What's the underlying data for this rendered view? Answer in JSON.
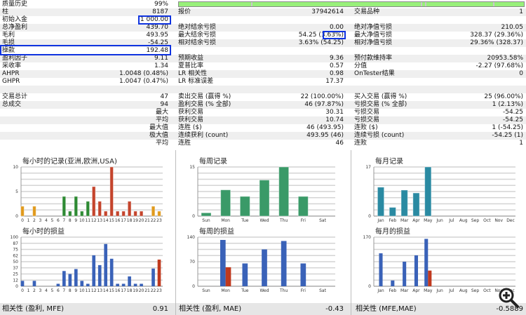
{
  "quality": {
    "label": "质量历史",
    "value": "99%"
  },
  "stats_rows": [
    [
      "柱",
      "8187",
      "报价",
      "37942614",
      "交易品种",
      "1"
    ],
    [
      "初始入金",
      "1 000.00",
      "",
      "",
      "",
      ""
    ],
    [
      "总净盈利",
      "439.70",
      "绝对结余亏损",
      "0.00",
      "绝对净值亏损",
      "210.05"
    ],
    [
      "毛利",
      "493.95",
      "最大结余亏损",
      "54.25 (3.63%)",
      "最大净值亏损",
      "328.37 (29.36%)"
    ],
    [
      "毛损",
      "-54.25",
      "相对结余亏损",
      "3.63% (54.25)",
      "相对净值亏损",
      "29.36% (328.37)"
    ],
    [
      "操款",
      "192.48",
      "",
      "",
      "",
      ""
    ],
    [
      "盈利因子",
      "9.11",
      "预期收益",
      "9.36",
      "预付款维持率",
      "20953.58%"
    ],
    [
      "采收率",
      "1.34",
      "夏普比率",
      "0.57",
      "分值",
      "-2.27 (97.68%)"
    ],
    [
      "AHPR",
      "1.0048 (0.48%)",
      "LR 相关性",
      "0.98",
      "OnTester结果",
      "0"
    ],
    [
      "GHPR",
      "1.0047 (0.47%)",
      "LR 标准误差",
      "17.37",
      "",
      ""
    ],
    [
      "",
      "",
      "",
      "",
      "",
      ""
    ],
    [
      "交易总计",
      "47",
      "卖出交易 (赢得 %)",
      "22 (100.00%)",
      "买入交易 (赢得 %)",
      "25 (96.00%)"
    ],
    [
      "总成交",
      "94",
      "盈利交易 (% 全部)",
      "46 (97.87%)",
      "亏损交易 (% 全部)",
      "1 (2.13%)"
    ],
    [
      "",
      "最大",
      "获利交易",
      "30.31",
      "亏损交易",
      "-54.25"
    ],
    [
      "",
      "平均",
      "获利交易",
      "10.74",
      "亏损交易",
      "-54.25"
    ],
    [
      "",
      "最大值",
      "连胜 ($)",
      "46 (493.95)",
      "连败 ($)",
      "1 (-54.25)"
    ],
    [
      "",
      "极大值",
      "连续获利 (count)",
      "493.95 (46)",
      "连续亏损 (count)",
      "-54.25 (1)"
    ],
    [
      "",
      "平均",
      "连胜",
      "46",
      "连败",
      "1"
    ]
  ],
  "chart_data": [
    {
      "type": "bar",
      "title": "每小时的记录(亚洲,欧洲,USA)",
      "categories": [
        "0",
        "1",
        "2",
        "3",
        "4",
        "5",
        "6",
        "7",
        "8",
        "9",
        "10",
        "11",
        "12",
        "13",
        "14",
        "15",
        "16",
        "17",
        "18",
        "19",
        "20",
        "21",
        "22",
        "23"
      ],
      "values": [
        2,
        0,
        2,
        0,
        0,
        0,
        0,
        4,
        1,
        4,
        1,
        3,
        6,
        3,
        1,
        10,
        1,
        1,
        3,
        1,
        1,
        0,
        2,
        1
      ],
      "ylim": [
        0,
        10
      ],
      "yticks": [
        "0",
        "5",
        "10"
      ],
      "colors_by_session": {
        "asia": "#e09a1c",
        "europe": "#2e8a34",
        "usa": "#c4442c"
      },
      "sessions": [
        "asia",
        "asia",
        "asia",
        "asia",
        "asia",
        "asia",
        "asia",
        "europe",
        "europe",
        "europe",
        "europe",
        "europe",
        "usa",
        "usa",
        "usa",
        "usa",
        "usa",
        "usa",
        "usa",
        "usa",
        "usa",
        "asia",
        "asia",
        "asia"
      ]
    },
    {
      "type": "bar",
      "title": "每小时的损益",
      "categories": [
        "0",
        "1",
        "2",
        "3",
        "4",
        "5",
        "6",
        "7",
        "8",
        "9",
        "10",
        "11",
        "12",
        "13",
        "14",
        "15",
        "16",
        "17",
        "18",
        "19",
        "20",
        "21",
        "22",
        "23"
      ],
      "series": [
        {
          "values": [
            11,
            0,
            11,
            0,
            0,
            0,
            5,
            31,
            25,
            35,
            11,
            5,
            63,
            43,
            86,
            56,
            5,
            5,
            20,
            5,
            5,
            0,
            36,
            0
          ],
          "color": "#3a62b8"
        },
        {
          "values": [
            0,
            0,
            0,
            0,
            0,
            0,
            0,
            0,
            0,
            0,
            0,
            0,
            0,
            0,
            0,
            0,
            0,
            0,
            0,
            0,
            0,
            0,
            0,
            54.25
          ],
          "color": "#c0391e"
        }
      ],
      "ylim": [
        0,
        100
      ],
      "yticks": [
        "0",
        "12",
        "25",
        "37",
        "50",
        "62",
        "75",
        "87",
        "100"
      ]
    },
    {
      "type": "bar",
      "title": "每周记录",
      "categories": [
        "Sun",
        "Mon",
        "Tue",
        "Wed",
        "Thu",
        "Fri",
        "Sat"
      ],
      "values": [
        1,
        8,
        6,
        11,
        15,
        6,
        0
      ],
      "color": "#3a9a68",
      "ylim": [
        0,
        15
      ],
      "yticks": [
        "0",
        "15"
      ]
    },
    {
      "type": "bar",
      "title": "每周的损益",
      "categories": [
        "Sun",
        "Mon",
        "Tue",
        "Wed",
        "Thu",
        "Fri",
        "Sat"
      ],
      "series": [
        {
          "values": [
            0,
            132,
            65,
            105,
            129,
            65,
            0
          ],
          "color": "#3a62b8"
        },
        {
          "values": [
            0,
            54.25,
            0,
            0,
            0,
            0,
            0
          ],
          "color": "#c0391e"
        }
      ],
      "ylim": [
        0,
        140
      ],
      "yticks": [
        "0",
        "70",
        "140"
      ]
    },
    {
      "type": "bar",
      "title": "每月记录",
      "categories": [
        "Jan",
        "Feb",
        "Mar",
        "Apr",
        "May",
        "Jun",
        "Jul",
        "Aug",
        "Sep",
        "Oct",
        "Nov",
        "Dec"
      ],
      "values": [
        10,
        3,
        9,
        8,
        17,
        0,
        0,
        0,
        0,
        0,
        0,
        0
      ],
      "color": "#2a8aa2",
      "ylim": [
        0,
        17
      ],
      "yticks": [
        "0",
        "17"
      ]
    },
    {
      "type": "bar",
      "title": "每月的损益",
      "categories": [
        "Jan",
        "Feb",
        "Mar",
        "Apr",
        "May",
        "Jun",
        "Jul",
        "Aug",
        "Sep",
        "Oct",
        "Nov",
        "Dec"
      ],
      "series": [
        {
          "values": [
            114,
            20,
            85,
            107,
            164,
            0,
            0,
            0,
            0,
            0,
            0,
            0
          ],
          "color": "#3a62b8"
        },
        {
          "values": [
            0,
            0,
            0,
            0,
            54.25,
            0,
            0,
            0,
            0,
            0,
            0,
            0
          ],
          "color": "#c0391e"
        }
      ],
      "ylim": [
        0,
        170
      ],
      "yticks": [
        "0",
        "170"
      ]
    }
  ],
  "correlations": [
    {
      "label": "相关性 (盈利, MFE)",
      "value": "0.91"
    },
    {
      "label": "相关性 (盈利, MAE)",
      "value": "-0.43"
    },
    {
      "label": "相关性 (MFE,MAE)",
      "value": "-0.5889"
    }
  ],
  "icons": {
    "zoom": "zoom-in-magnifier-icon"
  }
}
